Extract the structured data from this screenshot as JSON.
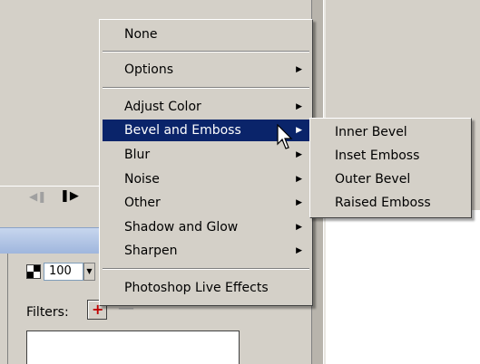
{
  "timeline": {
    "prev_icon": "step-back-icon",
    "play_icon": "play-icon"
  },
  "properties": {
    "opacity_value": "100",
    "filters_label": "Filters:"
  },
  "menu": {
    "items": [
      {
        "label": "None"
      },
      {
        "label": "Options"
      },
      {
        "label": "Adjust Color"
      },
      {
        "label": "Bevel and Emboss"
      },
      {
        "label": "Blur"
      },
      {
        "label": "Noise"
      },
      {
        "label": "Other"
      },
      {
        "label": "Shadow and Glow"
      },
      {
        "label": "Sharpen"
      },
      {
        "label": "Photoshop Live Effects"
      }
    ]
  },
  "submenu": {
    "items": [
      {
        "label": "Inner Bevel"
      },
      {
        "label": "Inset Emboss"
      },
      {
        "label": "Outer Bevel"
      },
      {
        "label": "Raised Emboss"
      }
    ]
  },
  "colors": {
    "highlight": "#0a246a",
    "face": "#d4d0c8"
  }
}
